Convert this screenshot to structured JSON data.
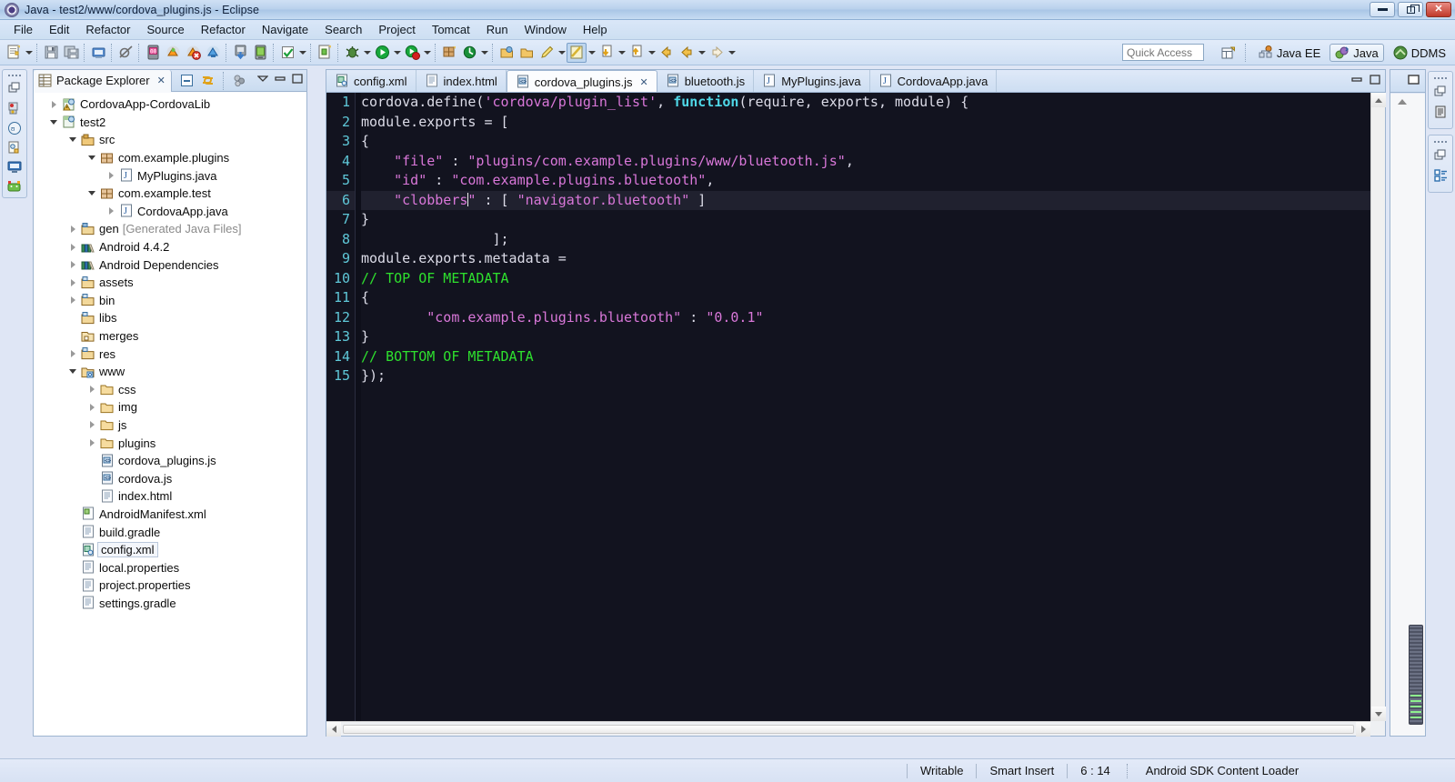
{
  "window": {
    "title": "Java - test2/www/cordova_plugins.js - Eclipse",
    "icon": "eclipse-icon",
    "minimize_label": "Minimize",
    "maximize_label": "Maximize",
    "close_label": "Close"
  },
  "menubar": {
    "items": [
      {
        "label": "File"
      },
      {
        "label": "Edit"
      },
      {
        "label": "Refactor"
      },
      {
        "label": "Source"
      },
      {
        "label": "Refactor"
      },
      {
        "label": "Navigate"
      },
      {
        "label": "Search"
      },
      {
        "label": "Project"
      },
      {
        "label": "Tomcat"
      },
      {
        "label": "Run"
      },
      {
        "label": "Window"
      },
      {
        "label": "Help"
      }
    ]
  },
  "toolbar": {
    "quick_access_placeholder": "Quick Access",
    "quick_access_value": "",
    "icons": [
      "new-wizard-icon",
      "save-icon",
      "save-all-icon",
      "print-icon",
      "skip-breakpoints-icon",
      "android-sdk-manager-icon",
      "android-avd-manager-icon",
      "lint-warnings-icon",
      "monitor-icon",
      "export-apk-icon",
      "device-icon",
      "check-icon",
      "new-android-icon",
      "debug-icon",
      "run-icon",
      "run-coverage-icon",
      "new-java-package-icon",
      "refresh-icon",
      "open-type-icon",
      "open-task-icon",
      "pencil-icon",
      "annotate-icon",
      "next-annotation-icon",
      "previous-annotation-icon",
      "back-icon",
      "forward-icon"
    ],
    "perspectives": [
      {
        "label": "Java EE",
        "icon": "java-ee-perspective-icon",
        "active": false
      },
      {
        "label": "Java",
        "icon": "java-perspective-icon",
        "active": true
      },
      {
        "label": "DDMS",
        "icon": "ddms-perspective-icon",
        "active": false
      }
    ],
    "open_perspective_label": "Open Perspective"
  },
  "left_rail": {
    "icons": [
      "restore-icon",
      "debug-view-icon",
      "junit-view-icon",
      "javadoc-view-icon",
      "console-view-icon",
      "logcat-view-icon"
    ]
  },
  "right_rails": [
    {
      "icons": [
        "restore-icon",
        "outline-view-icon"
      ]
    },
    {
      "icons": [
        "restore-icon",
        "task-list-view-icon"
      ]
    }
  ],
  "package_explorer": {
    "tab_label": "Package Explorer",
    "tab_icon": "package-explorer-icon",
    "close_label": "Close",
    "toolbar": [
      {
        "name": "collapse-all-icon"
      },
      {
        "name": "link-with-editor-icon"
      },
      {
        "name": "view-menu-filter-icon"
      }
    ],
    "view_controls": [
      {
        "name": "view-menu-icon"
      },
      {
        "name": "minimize-icon"
      },
      {
        "name": "maximize-icon"
      }
    ],
    "tree": [
      {
        "label": "CordovaApp-CordovaLib",
        "indent": 0,
        "twisty": "collapsed",
        "icon": "java-project-warning-icon",
        "selected": false
      },
      {
        "label": "test2",
        "indent": 0,
        "twisty": "expanded",
        "icon": "java-project-icon",
        "selected": false
      },
      {
        "label": "src",
        "indent": 1,
        "twisty": "expanded",
        "icon": "source-folder-icon",
        "selected": false
      },
      {
        "label": "com.example.plugins",
        "indent": 2,
        "twisty": "expanded",
        "icon": "package-icon",
        "selected": false
      },
      {
        "label": "MyPlugins.java",
        "indent": 3,
        "twisty": "collapsed",
        "icon": "java-file-icon",
        "selected": false
      },
      {
        "label": "com.example.test",
        "indent": 2,
        "twisty": "expanded",
        "icon": "package-icon",
        "selected": false
      },
      {
        "label": "CordovaApp.java",
        "indent": 3,
        "twisty": "collapsed",
        "icon": "java-file-icon",
        "selected": false
      },
      {
        "label": "gen",
        "suffix": " [Generated Java Files]",
        "indent": 1,
        "twisty": "collapsed",
        "icon": "gen-folder-icon",
        "selected": false
      },
      {
        "label": "Android 4.4.2",
        "indent": 1,
        "twisty": "collapsed",
        "icon": "library-icon",
        "selected": false
      },
      {
        "label": "Android Dependencies",
        "indent": 1,
        "twisty": "collapsed",
        "icon": "library-icon",
        "selected": false
      },
      {
        "label": "assets",
        "indent": 1,
        "twisty": "collapsed",
        "icon": "folder-icon",
        "selected": false
      },
      {
        "label": "bin",
        "indent": 1,
        "twisty": "collapsed",
        "icon": "folder-icon",
        "selected": false
      },
      {
        "label": "libs",
        "indent": 1,
        "twisty": "none",
        "icon": "folder-icon",
        "selected": false
      },
      {
        "label": "merges",
        "indent": 1,
        "twisty": "none",
        "icon": "folder-plain-icon",
        "selected": false
      },
      {
        "label": "res",
        "indent": 1,
        "twisty": "collapsed",
        "icon": "folder-icon",
        "selected": false
      },
      {
        "label": "www",
        "indent": 1,
        "twisty": "expanded",
        "icon": "folder-linked-icon",
        "selected": false
      },
      {
        "label": "css",
        "indent": 2,
        "twisty": "collapsed",
        "icon": "plain-folder-icon",
        "selected": false
      },
      {
        "label": "img",
        "indent": 2,
        "twisty": "collapsed",
        "icon": "plain-folder-icon",
        "selected": false
      },
      {
        "label": "js",
        "indent": 2,
        "twisty": "collapsed",
        "icon": "plain-folder-icon",
        "selected": false
      },
      {
        "label": "plugins",
        "indent": 2,
        "twisty": "collapsed",
        "icon": "plain-folder-icon",
        "selected": false
      },
      {
        "label": "cordova_plugins.js",
        "indent": 2,
        "twisty": "none",
        "icon": "js-file-icon",
        "selected": false
      },
      {
        "label": "cordova.js",
        "indent": 2,
        "twisty": "none",
        "icon": "js-file-icon",
        "selected": false
      },
      {
        "label": "index.html",
        "indent": 2,
        "twisty": "none",
        "icon": "html-file-icon",
        "selected": false
      },
      {
        "label": "AndroidManifest.xml",
        "indent": 1,
        "twisty": "none",
        "icon": "android-manifest-icon",
        "selected": false
      },
      {
        "label": "build.gradle",
        "indent": 1,
        "twisty": "none",
        "icon": "text-file-icon",
        "selected": false
      },
      {
        "label": "config.xml",
        "indent": 1,
        "twisty": "none",
        "icon": "xml-file-icon",
        "selected": true
      },
      {
        "label": "local.properties",
        "indent": 1,
        "twisty": "none",
        "icon": "text-file-icon",
        "selected": false
      },
      {
        "label": "project.properties",
        "indent": 1,
        "twisty": "none",
        "icon": "text-file-icon",
        "selected": false
      },
      {
        "label": "settings.gradle",
        "indent": 1,
        "twisty": "none",
        "icon": "text-file-icon",
        "selected": false
      }
    ]
  },
  "editor": {
    "tabs": [
      {
        "label": "config.xml",
        "icon": "xml-file-icon",
        "active": false,
        "closable": false
      },
      {
        "label": "index.html",
        "icon": "html-file-icon",
        "active": false,
        "closable": false
      },
      {
        "label": "cordova_plugins.js",
        "icon": "js-file-icon",
        "active": true,
        "closable": true,
        "close_label": "✗"
      },
      {
        "label": "bluetooth.js",
        "icon": "js-file-icon",
        "active": false,
        "closable": false
      },
      {
        "label": "MyPlugins.java",
        "icon": "java-file-icon",
        "active": false,
        "closable": false
      },
      {
        "label": "CordovaApp.java",
        "icon": "java-file-icon",
        "active": false,
        "closable": false
      }
    ],
    "controls": [
      {
        "name": "minimize-icon"
      },
      {
        "name": "maximize-icon"
      }
    ],
    "current_line": 6,
    "lines": [
      {
        "n": 1,
        "tokens": [
          {
            "t": "cordova.define(",
            "c": "pl"
          },
          {
            "t": "'cordova/plugin_list'",
            "c": "str"
          },
          {
            "t": ", ",
            "c": "pl"
          },
          {
            "t": "function",
            "c": "kw"
          },
          {
            "t": "(require, exports, module) {",
            "c": "pl"
          }
        ]
      },
      {
        "n": 2,
        "tokens": [
          {
            "t": "module.exports = [",
            "c": "pl"
          }
        ]
      },
      {
        "n": 3,
        "tokens": [
          {
            "t": "{",
            "c": "pl"
          }
        ]
      },
      {
        "n": 4,
        "tokens": [
          {
            "t": "    ",
            "c": "pl"
          },
          {
            "t": "\"file\"",
            "c": "str"
          },
          {
            "t": " : ",
            "c": "pl"
          },
          {
            "t": "\"plugins/com.example.plugins/www/bluetooth.js\"",
            "c": "str"
          },
          {
            "t": ",",
            "c": "pl"
          }
        ]
      },
      {
        "n": 5,
        "tokens": [
          {
            "t": "    ",
            "c": "pl"
          },
          {
            "t": "\"id\"",
            "c": "str"
          },
          {
            "t": " : ",
            "c": "pl"
          },
          {
            "t": "\"com.example.plugins.bluetooth\"",
            "c": "str"
          },
          {
            "t": ",",
            "c": "pl"
          }
        ]
      },
      {
        "n": 6,
        "tokens": [
          {
            "t": "    ",
            "c": "pl"
          },
          {
            "t": "\"clobbers",
            "c": "str"
          },
          {
            "t": "|CARET|",
            "c": "caret"
          },
          {
            "t": "\"",
            "c": "str"
          },
          {
            "t": " : [ ",
            "c": "pl"
          },
          {
            "t": "\"navigator.bluetooth\"",
            "c": "str"
          },
          {
            "t": " ]",
            "c": "pl"
          }
        ]
      },
      {
        "n": 7,
        "tokens": [
          {
            "t": "}",
            "c": "pl"
          }
        ]
      },
      {
        "n": 8,
        "tokens": [
          {
            "t": "                ];",
            "c": "pl"
          }
        ]
      },
      {
        "n": 9,
        "tokens": [
          {
            "t": "module.exports.metadata = ",
            "c": "pl"
          }
        ]
      },
      {
        "n": 10,
        "tokens": [
          {
            "t": "// TOP OF METADATA",
            "c": "cmt"
          }
        ]
      },
      {
        "n": 11,
        "tokens": [
          {
            "t": "{",
            "c": "pl"
          }
        ]
      },
      {
        "n": 12,
        "tokens": [
          {
            "t": "        ",
            "c": "pl"
          },
          {
            "t": "\"com.example.plugins.bluetooth\"",
            "c": "str"
          },
          {
            "t": " : ",
            "c": "pl"
          },
          {
            "t": "\"0.0.1\"",
            "c": "str"
          }
        ]
      },
      {
        "n": 13,
        "tokens": [
          {
            "t": "}",
            "c": "pl"
          }
        ]
      },
      {
        "n": 14,
        "tokens": [
          {
            "t": "// BOTTOM OF METADATA",
            "c": "cmt"
          }
        ]
      },
      {
        "n": 15,
        "tokens": [
          {
            "t": "});",
            "c": "pl"
          }
        ]
      }
    ],
    "colors": {
      "background": "#12131f",
      "plain": "#dcdce8",
      "string": "#d977d9",
      "keyword": "#4fd8e8",
      "comment": "#2ee02e",
      "line_number": "#5fc8d8",
      "current_line_background": "#20212f"
    }
  },
  "outline_strip": {
    "restore_label": "Restore",
    "icon": "maximize-icon"
  },
  "statusbar": {
    "writable": "Writable",
    "insert_mode": "Smart Insert",
    "position": "6 : 14",
    "task": "Android SDK Content Loader"
  }
}
